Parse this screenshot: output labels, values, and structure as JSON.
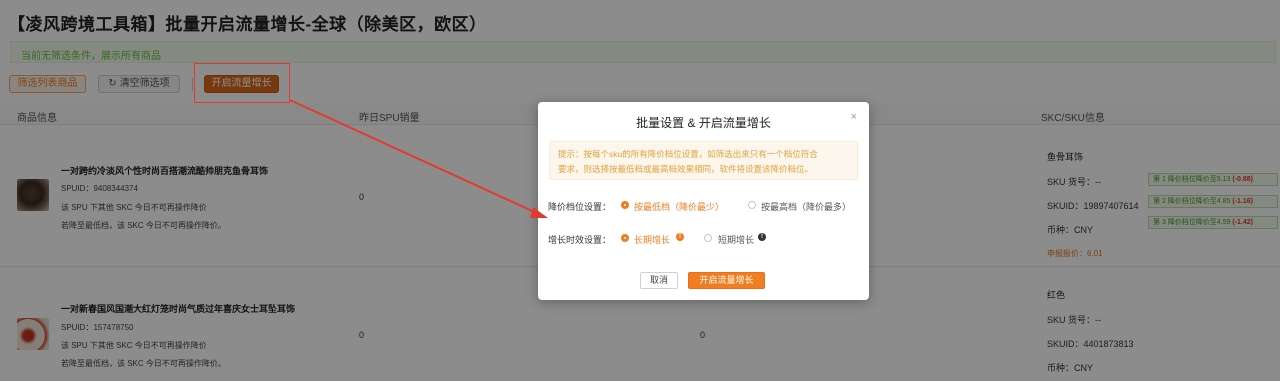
{
  "page": {
    "title": "【凌风跨境工具箱】批量开启流量增长-全球（除美区，欧区）",
    "notice": "当前无筛选条件，展示所有商品"
  },
  "toolbar": {
    "filter_label": "筛选列表商品",
    "clear_label": "清空筛选项",
    "start_label": "开启流量增长"
  },
  "table": {
    "headers": {
      "product": "商品信息",
      "spu_sales": "昨日SPU销量",
      "skc_sku": "SKC/SKU信息"
    },
    "rows": [
      {
        "title": "一对跨约冷淡风个性时尚百搭潮流酷帅朋克鱼骨耳饰",
        "spuid": "SPUID：9408344374",
        "line1": "该 SPU 下其他 SKC 今日不可再操作降价",
        "line2": "若降至最低档，该 SKC 今日不可再操作降价。",
        "sales": "0",
        "sales2": "",
        "skc_name": "鱼骨耳饰",
        "sku_code": "SKU 货号：--",
        "skuid": "SKUID：19897407614",
        "currency": "币种：CNY",
        "price": "申报报价：6.01",
        "tags": [
          {
            "text": "第 1 降价档位降价至5.13",
            "delta": "(-0.88)"
          },
          {
            "text": "第 2 降价档位降价至4.85",
            "delta": "(-1.16)"
          },
          {
            "text": "第 3 降价档位降价至4.59",
            "delta": "(-1.42)"
          }
        ]
      },
      {
        "title": "一对新春国风国潮大红灯笼时尚气质过年喜庆女士耳坠耳饰",
        "spuid": "SPUID：157478750",
        "line1": "该 SPU 下其他 SKC 今日不可再操作降价",
        "line2": "若降至最低档，该 SKC 今日不可再操作降价。",
        "sales": "0",
        "sales2": "0",
        "skc_name": "红色",
        "sku_code": "SKU 货号：--",
        "skuid": "SKUID：4401873813",
        "currency": "币种：CNY"
      }
    ]
  },
  "modal": {
    "title": "批量设置 & 开启流量增长",
    "close": "×",
    "tip_line1": "提示：按每个sku的所有降价档位设置，如筛选出来只有一个档位符合",
    "tip_line2": "要求，则选择按最低档或最高档效果相同，软件将设置该降价档位。",
    "price_label": "降价档位设置：",
    "price_opt1": "按最低档（降价最少）",
    "price_opt2": "按最高档（降价最多）",
    "growth_label": "增长时效设置：",
    "growth_opt1": "长期增长",
    "growth_opt2": "短期增长",
    "info1": "!",
    "info2": "!",
    "cancel": "取消",
    "confirm": "开启流量增长"
  },
  "colors": {
    "accent": "#f07d1f",
    "highlight_box": "#e23b2e",
    "success": "#67c23a"
  }
}
